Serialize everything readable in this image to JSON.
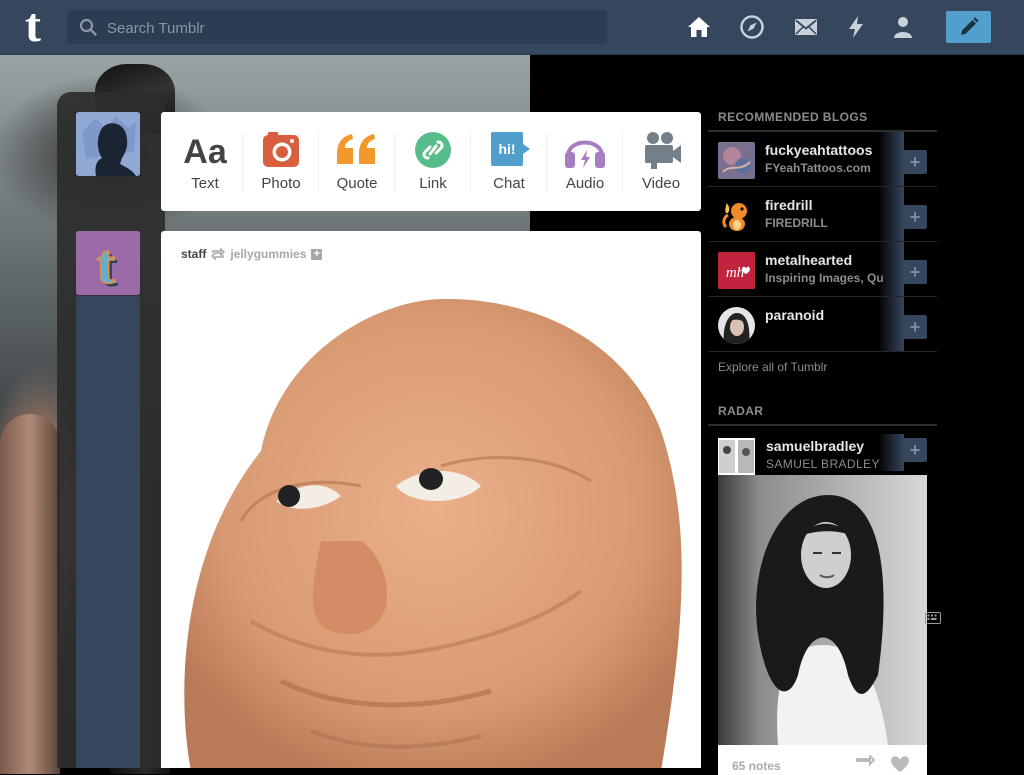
{
  "header": {
    "logo": "t",
    "search_placeholder": "Search Tumblr",
    "nav": [
      "home-icon",
      "explore-icon",
      "inbox-icon",
      "activity-icon",
      "account-icon"
    ],
    "compose_icon": "pencil-icon"
  },
  "post_types": [
    {
      "label": "Text",
      "icon": "text-icon",
      "glyph": "Aa",
      "color": "#444444"
    },
    {
      "label": "Photo",
      "icon": "camera-icon",
      "color": "#d95e40"
    },
    {
      "label": "Quote",
      "icon": "quote-icon",
      "color": "#f2992e"
    },
    {
      "label": "Link",
      "icon": "link-icon",
      "color": "#56bc8a"
    },
    {
      "label": "Chat",
      "icon": "chat-icon",
      "glyph": "hi!",
      "color": "#529ecc"
    },
    {
      "label": "Audio",
      "icon": "headphones-icon",
      "color": "#a77dc2"
    },
    {
      "label": "Video",
      "icon": "video-camera-icon",
      "color": "#748089"
    }
  ],
  "post": {
    "author": "staff",
    "reblogged_from": "jellygummies",
    "follow_label": "+"
  },
  "recommended": {
    "title": "RECOMMENDED BLOGS",
    "items": [
      {
        "name": "fuckyeahtattoos",
        "sub": "FYeahTattoos.com",
        "plus": "+"
      },
      {
        "name": "firedrill",
        "sub": "FIREDRILL",
        "plus": "+"
      },
      {
        "name": "metalhearted",
        "sub": "Inspiring Images, Qu",
        "plus": "+",
        "avatar_text": "mh"
      },
      {
        "name": "paranoid",
        "sub": "",
        "plus": "+"
      }
    ],
    "explore": "Explore all of Tumblr"
  },
  "radar": {
    "title": "RADAR",
    "name": "samuelbradley",
    "sub": "SAMUEL BRADLEY",
    "plus": "+",
    "notes": "65 notes"
  },
  "colors": {
    "header_bg": "#36465d",
    "compose_bg": "#529ecc",
    "page_bg": "#000000"
  }
}
